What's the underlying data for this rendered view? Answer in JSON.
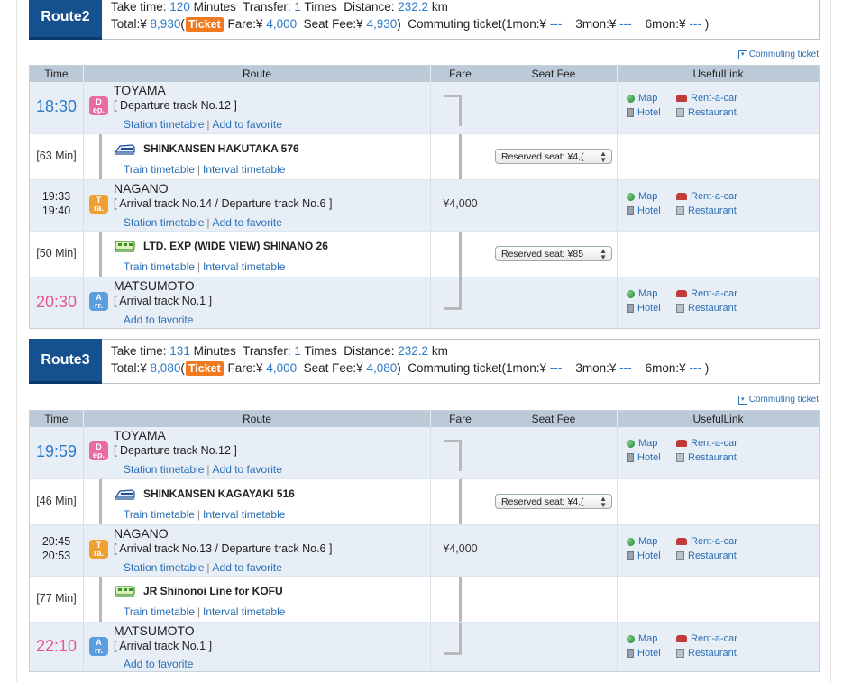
{
  "routes": [
    {
      "badge": "Route2",
      "take_label": "Take time:",
      "take_value": "120",
      "take_unit": "Minutes",
      "transfer_label": "Transfer:",
      "transfer_value": "1",
      "transfer_unit": "Times",
      "distance_label": "Distance:",
      "distance_value": "232.2",
      "distance_unit": "km",
      "total_label": "Total:¥",
      "total_value": "8,930",
      "open_paren": "(",
      "ticket_label": "Ticket",
      "fare_label": "Fare:¥",
      "fare_value": "4,000",
      "seatfee_label": "Seat Fee:¥",
      "seatfee_value": "4,930",
      "close_paren": ")",
      "commuting_label": "Commuting ticket(1mon:¥",
      "m1": "---",
      "m3_label": "3mon:¥",
      "m3": "---",
      "m6_label": "6mon:¥",
      "m6": "---",
      "end_paren": ")",
      "commuting_link": "Commuting ticket",
      "header": [
        "Time",
        "Route",
        "Fare",
        "Seat Fee",
        "UsefulLink"
      ],
      "stations": [
        {
          "time": "18:30",
          "name": "TOYAMA",
          "track": "[ Departure track No.12 ]",
          "icon_top": "D",
          "icon_bot": "ep.",
          "links": [
            "Station timetable",
            "Add to favorite"
          ]
        },
        {
          "time_arr": "19:33",
          "time_dep": "19:40",
          "name": "NAGANO",
          "track": "[ Arrival track No.14 / Departure track No.6 ]",
          "icon_top": "T",
          "icon_bot": "ra.",
          "links": [
            "Station timetable",
            "Add to favorite"
          ],
          "fare": "¥4,000"
        },
        {
          "time": "20:30",
          "name": "MATSUMOTO",
          "track": "[ Arrival track No.1 ]",
          "icon_top": "A",
          "icon_bot": "rr.",
          "links": [
            "Add to favorite"
          ]
        }
      ],
      "segments": [
        {
          "mins": "[63 Min]",
          "train": "SHINKANSEN HAKUTAKA 576",
          "links": [
            "Train timetable",
            "Interval timetable"
          ],
          "seat": "Reserved seat: ¥4,("
        },
        {
          "mins": "[50 Min]",
          "train": "LTD. EXP (WIDE VIEW) SHINANO 26",
          "links": [
            "Train timetable",
            "Interval timetable"
          ],
          "seat": "Reserved seat: ¥85"
        }
      ]
    },
    {
      "badge": "Route3",
      "take_label": "Take time:",
      "take_value": "131",
      "take_unit": "Minutes",
      "transfer_label": "Transfer:",
      "transfer_value": "1",
      "transfer_unit": "Times",
      "distance_label": "Distance:",
      "distance_value": "232.2",
      "distance_unit": "km",
      "total_label": "Total:¥",
      "total_value": "8,080",
      "open_paren": "(",
      "ticket_label": "Ticket",
      "fare_label": "Fare:¥",
      "fare_value": "4,000",
      "seatfee_label": "Seat Fee:¥",
      "seatfee_value": "4,080",
      "close_paren": ")",
      "commuting_label": "Commuting ticket(1mon:¥",
      "m1": "---",
      "m3_label": "3mon:¥",
      "m3": "---",
      "m6_label": "6mon:¥",
      "m6": "---",
      "end_paren": ")",
      "commuting_link": "Commuting ticket",
      "header": [
        "Time",
        "Route",
        "Fare",
        "Seat Fee",
        "UsefulLink"
      ],
      "stations": [
        {
          "time": "19:59",
          "name": "TOYAMA",
          "track": "[ Departure track No.12 ]",
          "icon_top": "D",
          "icon_bot": "ep.",
          "links": [
            "Station timetable",
            "Add to favorite"
          ]
        },
        {
          "time_arr": "20:45",
          "time_dep": "20:53",
          "name": "NAGANO",
          "track": "[ Arrival track No.13 / Departure track No.6 ]",
          "icon_top": "T",
          "icon_bot": "ra.",
          "links": [
            "Station timetable",
            "Add to favorite"
          ],
          "fare": "¥4,000"
        },
        {
          "time": "22:10",
          "name": "MATSUMOTO",
          "track": "[ Arrival track No.1 ]",
          "icon_top": "A",
          "icon_bot": "rr.",
          "links": [
            "Add to favorite"
          ]
        }
      ],
      "segments": [
        {
          "mins": "[46 Min]",
          "train": "SHINKANSEN KAGAYAKI 516",
          "links": [
            "Train timetable",
            "Interval timetable"
          ],
          "seat": "Reserved seat: ¥4,("
        },
        {
          "mins": "[77 Min]",
          "train": "JR Shinonoi Line  for KOFU",
          "links": [
            "Train timetable",
            "Interval timetable"
          ]
        }
      ]
    }
  ],
  "useful": {
    "map": "Map",
    "car": "Rent-a-car",
    "hotel": "Hotel",
    "restaurant": "Restaurant"
  },
  "colors": {
    "badge": "#15508f",
    "ticket": "#f07a1f",
    "dep_time": "#2b79c9",
    "arr_time": "#e4568f",
    "station_bg": "#e7eef6",
    "header_bg": "#bccad8"
  }
}
